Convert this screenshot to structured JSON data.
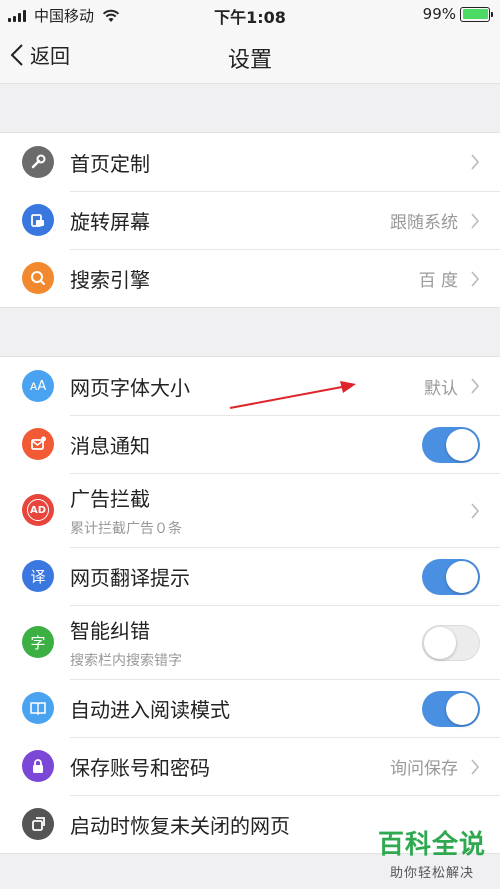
{
  "status_bar": {
    "carrier": "中国移动",
    "time": "下午1:08",
    "battery": "99%"
  },
  "nav": {
    "back_label": "返回",
    "title": "设置"
  },
  "groups": [
    {
      "items": [
        {
          "label": "首页定制",
          "icon": "wrench-icon",
          "icon_color": "#6b6b6b"
        },
        {
          "label": "旋转屏幕",
          "value": "跟随系统",
          "icon": "rotate-screen-icon",
          "icon_color": "#3a78e0"
        },
        {
          "label": "搜索引擎",
          "value": "百 度",
          "icon": "search-icon",
          "icon_color": "#f2892e"
        }
      ]
    },
    {
      "items": [
        {
          "label": "网页字体大小",
          "value": "默认",
          "icon": "font-size-icon",
          "icon_glyph": "ᴀA",
          "icon_color": "#4aa3f0"
        },
        {
          "label": "消息通知",
          "toggle": true,
          "icon": "message-icon",
          "icon_color": "#f25a36"
        },
        {
          "label": "广告拦截",
          "sub": "累计拦截广告０条",
          "icon": "ad-block-icon",
          "icon_glyph": "AD",
          "icon_color": "#e8453c"
        },
        {
          "label": "网页翻译提示",
          "toggle": true,
          "icon": "translate-icon",
          "icon_glyph": "译",
          "icon_color": "#3a78e0"
        },
        {
          "label": "智能纠错",
          "sub": "搜索栏内搜索错字",
          "toggle": false,
          "icon": "char-icon",
          "icon_glyph": "字",
          "icon_color": "#3cb043"
        },
        {
          "label": "自动进入阅读模式",
          "toggle": true,
          "icon": "book-icon",
          "icon_color": "#4aa3f0"
        },
        {
          "label": "保存账号和密码",
          "value": "询问保存",
          "icon": "lock-icon",
          "icon_color": "#7b47d6"
        },
        {
          "label": "启动时恢复未关闭的网页",
          "icon": "restore-pages-icon",
          "icon_color": "#555555"
        }
      ]
    }
  ],
  "watermark": {
    "title": "百科全说",
    "subtitle": "助你轻松解决"
  },
  "colors": {
    "toggle_on": "#4a90e2",
    "annotation_arrow": "#e0242a"
  }
}
